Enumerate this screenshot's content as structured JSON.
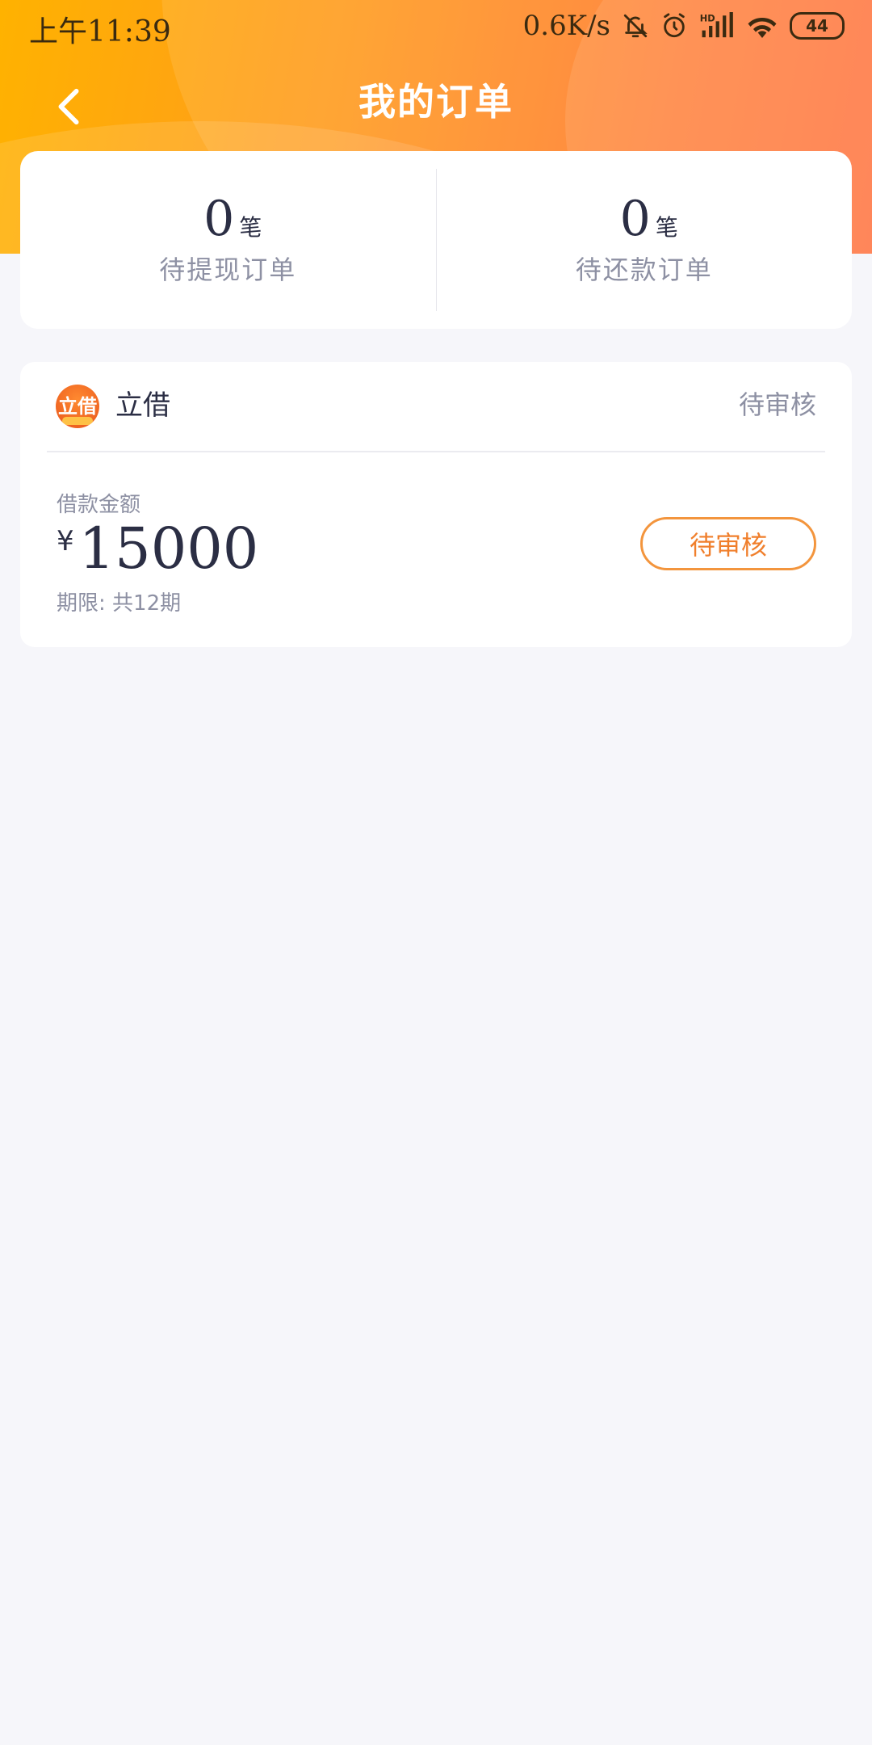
{
  "status_bar": {
    "time": "上午11:39",
    "net_speed": "0.6K/s",
    "battery": "44",
    "icons": [
      "bell-off-icon",
      "alarm-icon",
      "hd-signal-icon",
      "wifi-icon",
      "battery-icon"
    ]
  },
  "nav": {
    "back_icon": "chevron-left-icon",
    "title": "我的订单"
  },
  "summary": {
    "withdraw": {
      "count": "0",
      "unit": "笔",
      "label": "待提现订单"
    },
    "repay": {
      "count": "0",
      "unit": "笔",
      "label": "待还款订单"
    }
  },
  "order": {
    "brand_logo_text": "立借",
    "brand_name": "立借",
    "status": "待审核",
    "amount_label": "借款金额",
    "currency": "¥",
    "amount": "15000",
    "term": "期限: 共12期",
    "action_label": "待审核"
  },
  "colors": {
    "header_gradient_start": "#ffb200",
    "header_gradient_end": "#ff6a34",
    "accent_orange": "#f07f2c",
    "text_dark": "#2b2e44",
    "text_muted": "#8d90a3",
    "background": "#f6f6fa"
  }
}
